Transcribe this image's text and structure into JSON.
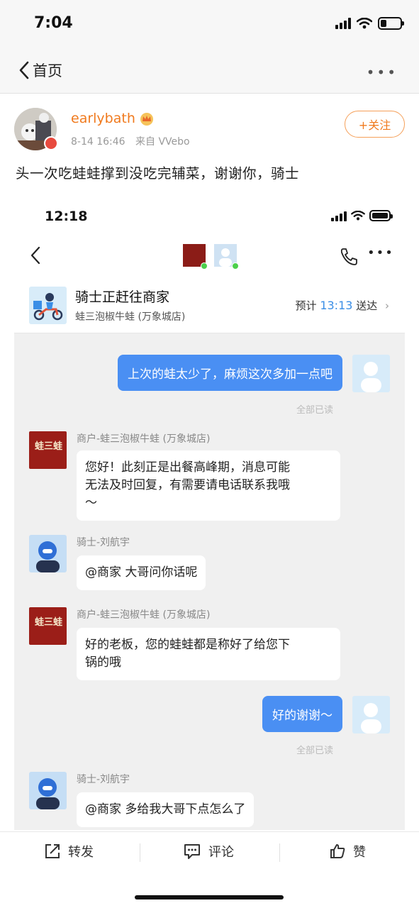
{
  "status_bar": {
    "time": "7:04"
  },
  "nav": {
    "back_label": "首页"
  },
  "post": {
    "username": "earlybath",
    "date": "8-14 16:46",
    "source": "来自 VVebo",
    "follow_label": "+关注",
    "text": "头一次吃蛙蛙撑到没吃完辅菜，谢谢你，骑士"
  },
  "embedded": {
    "status_time": "12:18",
    "order": {
      "status": "骑士正赶往商家",
      "shop_name": "蛙三泡椒牛蛙 (万象城店)",
      "eta_prefix": "预计",
      "eta_time": "13:13",
      "eta_suffix": "送达"
    },
    "shop_logo_text": "蛙三蛙",
    "messages": [
      {
        "from": "me",
        "text": "上次的蛙太少了，麻烦这次多加一点吧",
        "read": "全部已读"
      },
      {
        "from": "shop",
        "sender": "商户-蛙三泡椒牛蛙 (万象城店)",
        "lines": [
          "您好！此刻正是出餐高峰期，消息可能",
          "无法及时回复，有需要请电话联系我哦",
          "～"
        ]
      },
      {
        "from": "rider",
        "sender": "骑士-刘航宇",
        "text": "@商家 大哥问你话呢"
      },
      {
        "from": "shop",
        "sender": "商户-蛙三泡椒牛蛙 (万象城店)",
        "lines": [
          "好的老板，您的蛙蛙都是称好了给您下",
          "锅的哦"
        ]
      },
      {
        "from": "me",
        "text": "好的谢谢～",
        "read": "全部已读"
      },
      {
        "from": "rider",
        "sender": "骑士-刘航宇",
        "text": "@商家 多给我大哥下点怎么了"
      }
    ]
  },
  "actions": {
    "repost": "转发",
    "comment": "评论",
    "like": "赞"
  },
  "colors": {
    "accent_orange": "#f07a1e",
    "bubble_blue": "#4a8ff3",
    "eta_blue": "#3a8ee6"
  },
  "icons": [
    "back-chevron-icon",
    "more-icon",
    "crown-icon",
    "phone-icon",
    "repost-icon",
    "comment-icon",
    "like-icon",
    "signal-icon",
    "wifi-icon",
    "battery-icon"
  ]
}
